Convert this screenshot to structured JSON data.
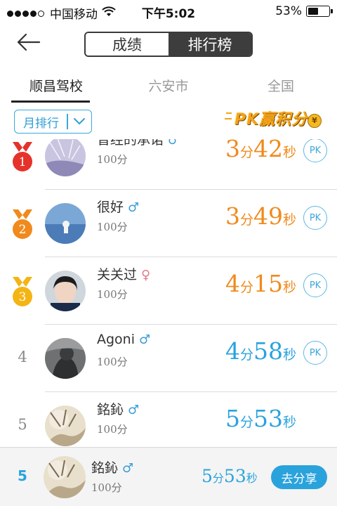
{
  "status_bar": {
    "carrier": "中国移动",
    "time": "下午5:02",
    "battery_percent": "53%",
    "battery_level": 0.53,
    "signal_bars_filled": 4,
    "signal_bars_total": 5
  },
  "nav": {
    "back_icon": "arrow-left-icon",
    "segments": [
      "成绩",
      "排行榜"
    ],
    "active_segment": 1
  },
  "region_tabs": [
    "顺昌驾校",
    "六安市",
    "全国"
  ],
  "active_region_tab": 0,
  "filter": {
    "period_label": "月排行",
    "chevron_icon": "chevron-down-icon"
  },
  "pk_banner": {
    "text": "PK赢积分",
    "coin_symbol": "¥"
  },
  "rankings": [
    {
      "rank": "1",
      "name": "曾经的承诺",
      "gender": "♂",
      "gender_type": "male",
      "score": "100分",
      "minutes": "3",
      "min_unit": "分",
      "seconds": "42",
      "sec_unit": "秒",
      "pk_label": "PK",
      "medal_color": "#e5322b",
      "time_color": "orange"
    },
    {
      "rank": "2",
      "name": "很好",
      "gender": "♂",
      "gender_type": "male",
      "score": "100分",
      "minutes": "3",
      "min_unit": "分",
      "seconds": "49",
      "sec_unit": "秒",
      "pk_label": "PK",
      "medal_color": "#f08a1c",
      "time_color": "orange"
    },
    {
      "rank": "3",
      "name": "关关过",
      "gender": "♀",
      "gender_type": "female",
      "score": "100分",
      "minutes": "4",
      "min_unit": "分",
      "seconds": "15",
      "sec_unit": "秒",
      "pk_label": "PK",
      "medal_color": "#f4b414",
      "time_color": "orange"
    },
    {
      "rank": "4",
      "name": "Agoni",
      "gender": "♂",
      "gender_type": "male",
      "score": "100分",
      "minutes": "4",
      "min_unit": "分",
      "seconds": "58",
      "sec_unit": "秒",
      "pk_label": "PK",
      "time_color": "blue"
    },
    {
      "rank": "5",
      "name": "銘鈊",
      "gender": "♂",
      "gender_type": "male",
      "score": "100分",
      "minutes": "5",
      "min_unit": "分",
      "seconds": "53",
      "sec_unit": "秒",
      "time_color": "blue"
    }
  ],
  "my_rank": {
    "rank": "5",
    "name": "銘鈊",
    "gender": "♂",
    "score": "100分",
    "minutes": "5",
    "min_unit": "分",
    "seconds": "53",
    "sec_unit": "秒",
    "share_label": "去分享"
  },
  "colors": {
    "accent_blue": "#2aa3dd",
    "accent_orange": "#f08a1c",
    "segment_active_bg": "#3d3d3d"
  }
}
